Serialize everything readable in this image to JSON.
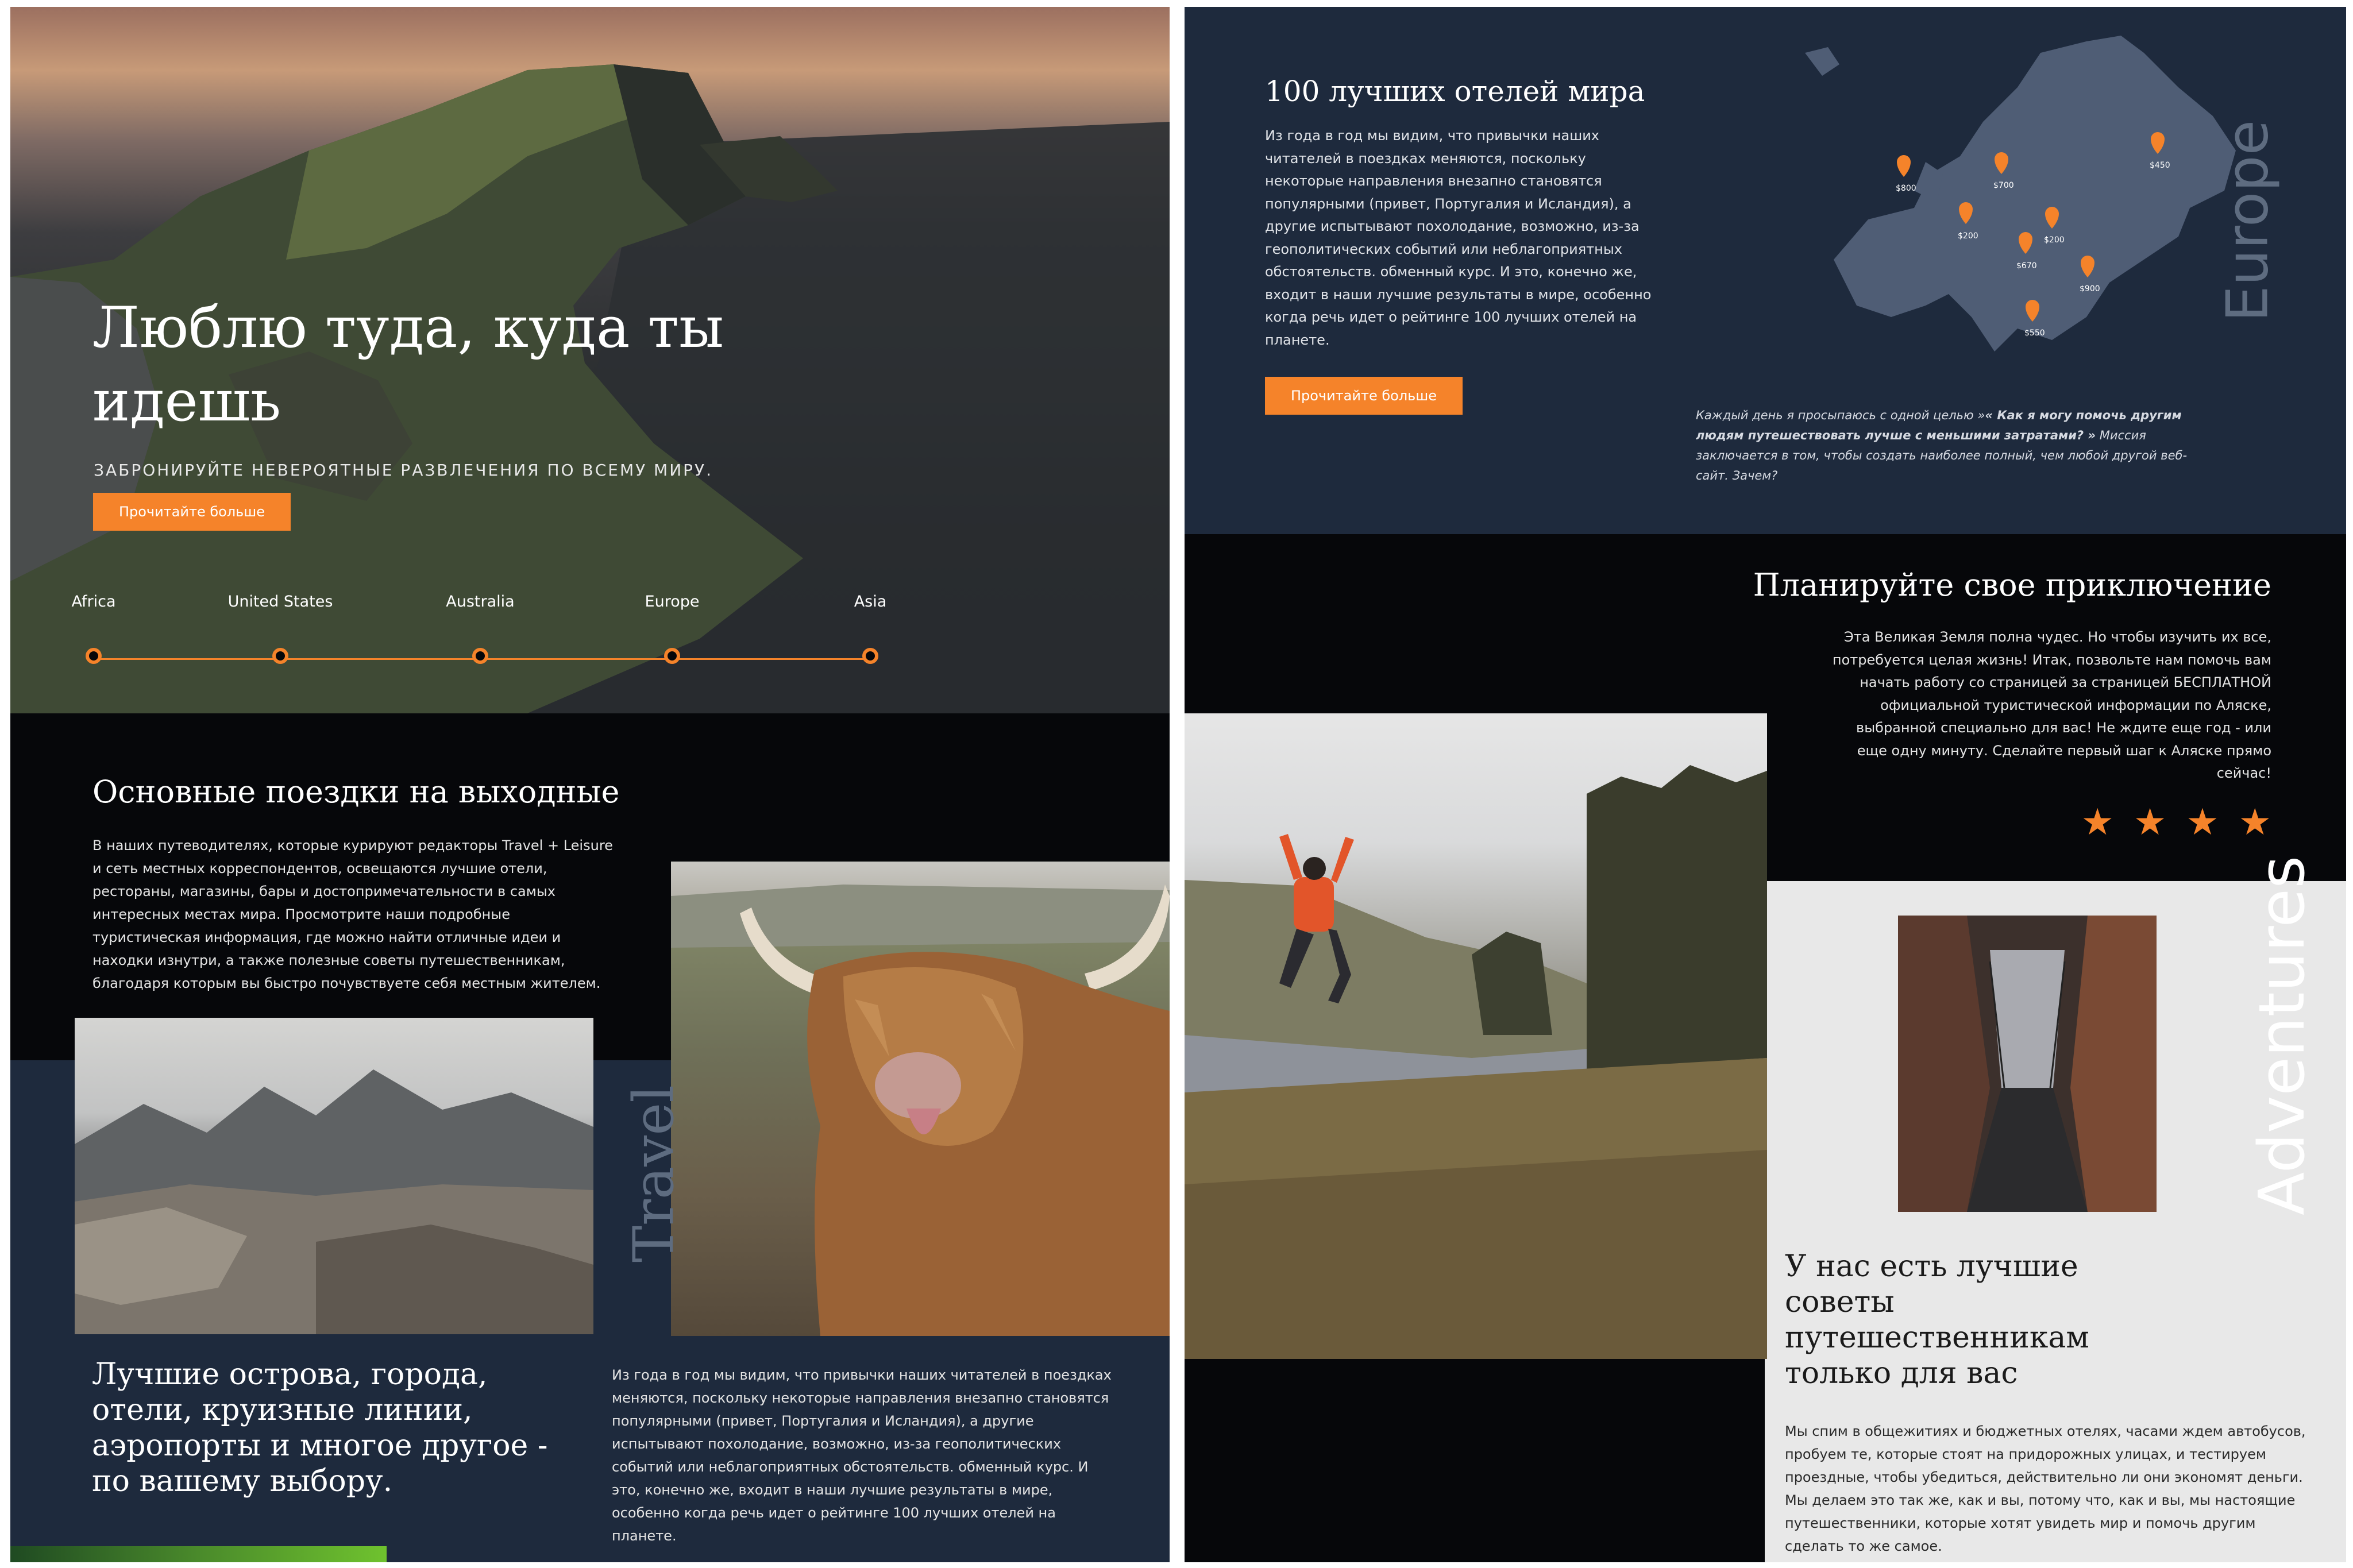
{
  "hero": {
    "title": "Люблю туда, куда ты идешь",
    "subtitle": "ЗАБРОНИРУЙТЕ НЕВЕРОЯТНЫЕ РАЗВЛЕЧЕНИЯ ПО ВСЕМУ МИРУ.",
    "button_label": "Прочитайте больше"
  },
  "timeline": {
    "stops": [
      "Africa",
      "United States",
      "Australia",
      "Europe",
      "Asia"
    ]
  },
  "trips": {
    "title": "Основные поездки на выходные",
    "body": "В наших путеводителях, которые курируют редакторы Travel + Leisure и сеть местных корреспондентов, освещаются лучшие отели, рестораны, магазины, бары и достопримечательности в самых интересных местах мира. Просмотрите наши подробные туристическая информация, где можно найти отличные идеи и находки изнутри, а также полезные советы путешественникам, благодаря которым вы быстро почувствуете себя местным жителем.",
    "travel_word": "Travel",
    "islands_text": "Лучшие острова, города, отели, круизные линии, аэропорты и многое другое - по вашему выбору.",
    "yak_text": "Из года в год мы видим, что привычки наших читателей в поездках меняются, поскольку некоторые направления внезапно становятся популярными (привет, Португалия и Исландия), а другие испытывают похолодание, возможно, из-за геополитических событий или неблагоприятных обстоятельств. обменный курс. И это, конечно же, входит в наши лучшие результаты в мире, особенно когда речь идет о рейтинге 100 лучших отелей на планете."
  },
  "hotels": {
    "title": "100 лучших отелей мира",
    "body": "Из года в год мы видим, что привычки наших читателей в поездках меняются, поскольку некоторые направления внезапно становятся популярными (привет, Португалия и Исландия), а другие испытывают похолодание, возможно, из-за геополитических событий или неблагоприятных обстоятельств. обменный курс. И это, конечно же, входит в наши лучшие результаты в мире, особенно когда речь идет о рейтинге 100 лучших отелей на планете.",
    "button_label": "Прочитайте больше",
    "europe_word": "Europe",
    "map_pins": [
      "$800",
      "$700",
      "$450",
      "$200",
      "$200",
      "$670",
      "$900",
      "$550"
    ],
    "quote_start": "Каждый день я просыпаюсь с одной целью »",
    "quote_bold": "« Как я могу помочь другим людям путешествовать лучше с меньшими затратами? »",
    "quote_end": " Миссия заключается в том, чтобы создать наиболее полный, чем любой другой веб-сайт. Зачем?"
  },
  "adventure": {
    "title": "Планируйте свое приключение",
    "body": "Эта Великая Земля полна чудес. Но чтобы изучить их все, потребуется целая жизнь! Итак, позвольте нам помочь вам начать работу со страницей за страницей БЕСПЛАТНОЙ официальной туристической информации по Аляске, выбранной специально для вас! Не ждите еще год - или еще одну минуту. Сделайте первый шаг к Аляске прямо сейчас!",
    "rating": 4,
    "adventures_word": "Adventures",
    "tips_title": "У нас есть лучшие советы путешественникам только для вас",
    "tips_body": "Мы спим в общежитиях и бюджетных отелях, часами ждем автобусов, пробуем те, которые стоят на придорожных улицах, и тестируем проездные, чтобы убедиться, действительно ли они экономят деньги. Мы делаем это так же, как и вы, потому что, как и вы, мы настоящие путешественники, которые хотят увидеть мир и помочь другим сделать то же самое."
  },
  "colors": {
    "accent": "#f5832a",
    "navy": "#1e2a3d",
    "dark": "#06070a",
    "grey": "#e8e8e8"
  }
}
